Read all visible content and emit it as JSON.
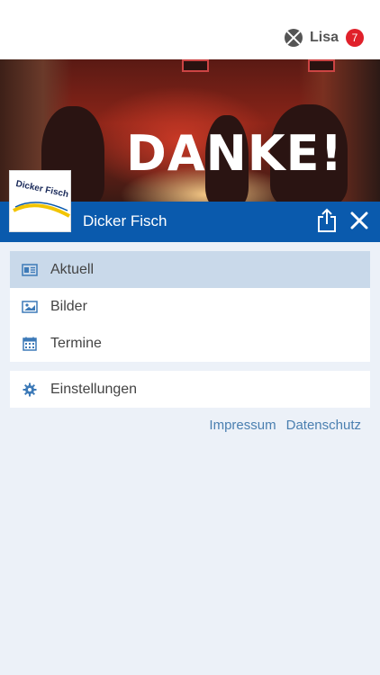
{
  "user": {
    "name": "Lisa",
    "badge_count": "7"
  },
  "hero": {
    "text": "DANKE!"
  },
  "logo": {
    "text": "Dicker Fisch"
  },
  "header": {
    "title": "Dicker Fisch"
  },
  "menu": {
    "items": [
      {
        "label": "Aktuell",
        "icon": "news-icon",
        "active": true
      },
      {
        "label": "Bilder",
        "icon": "image-icon",
        "active": false
      },
      {
        "label": "Termine",
        "icon": "calendar-icon",
        "active": false
      }
    ],
    "settings": {
      "label": "Einstellungen",
      "icon": "gear-icon"
    }
  },
  "footer": {
    "impressum": "Impressum",
    "datenschutz": "Datenschutz"
  },
  "colors": {
    "header_blue": "#0a5aad",
    "active_row": "#c9d9ea",
    "badge_red": "#e0202a",
    "link": "#4a7fb0",
    "background": "#ecf1f8"
  }
}
